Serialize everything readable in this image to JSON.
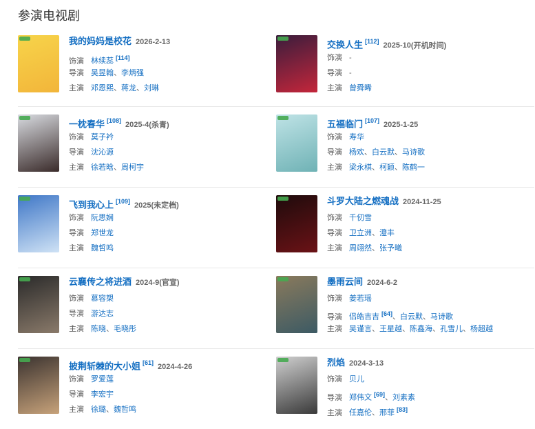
{
  "section_title": "参演电视剧",
  "labels": {
    "role": "饰演",
    "director": "导演",
    "starring": "主演"
  },
  "shows": [
    {
      "title": "我的妈妈是校花",
      "ref": "",
      "date": "2026-2-13",
      "extra": "",
      "role": [
        {
          "t": "林续蕊",
          "ref": "[114]"
        }
      ],
      "director": [
        {
          "t": "吴昱翰"
        },
        {
          "t": "李炳强"
        }
      ],
      "starring": [
        {
          "t": "邓恩熙"
        },
        {
          "t": "蒋龙"
        },
        {
          "t": "刘琳"
        }
      ],
      "poster_colors": [
        "#f7d44a",
        "#f2b53a"
      ]
    },
    {
      "title": "交换人生",
      "ref": "[112]",
      "date": "2025-10",
      "extra": "(开机时间)",
      "role_plain": "-",
      "director_plain": "-",
      "starring": [
        {
          "t": "曾舜晞"
        }
      ],
      "poster_colors": [
        "#3a1d3c",
        "#c4263b"
      ]
    },
    {
      "title": "一枕春华",
      "ref": "[108]",
      "date": "2025-4",
      "extra": "(杀青)",
      "role": [
        {
          "t": "莫子衿"
        }
      ],
      "director": [
        {
          "t": "沈沁源"
        }
      ],
      "starring": [
        {
          "t": "徐若晗"
        },
        {
          "t": "周柯宇"
        }
      ],
      "poster_colors": [
        "#d8dbe0",
        "#3a2b2a"
      ]
    },
    {
      "title": "五福临门",
      "ref": "[107]",
      "date": "2025-1-25",
      "extra": "",
      "role": [
        {
          "t": "寿华"
        }
      ],
      "director": [
        {
          "t": "杨欢"
        },
        {
          "t": "白云默"
        },
        {
          "t": "马诗歌"
        }
      ],
      "starring": [
        {
          "t": "梁永棋"
        },
        {
          "t": "柯颖"
        },
        {
          "t": "陈鹤一"
        }
      ],
      "poster_colors": [
        "#bfe3e6",
        "#6fb2b5"
      ]
    },
    {
      "title": "飞到我心上",
      "ref": "[109]",
      "date": "2025(未定档)",
      "extra": "",
      "role": [
        {
          "t": "阮思娴"
        }
      ],
      "director": [
        {
          "t": "郑世龙"
        }
      ],
      "starring": [
        {
          "t": "魏哲鸣"
        }
      ],
      "poster_colors": [
        "#3f77c7",
        "#cfe2f5"
      ]
    },
    {
      "title": "斗罗大陆之燃魂战",
      "ref": "",
      "date": "2024-11-25",
      "extra": "",
      "role": [
        {
          "t": "千仞雪"
        }
      ],
      "director": [
        {
          "t": "卫立洲"
        },
        {
          "t": "澄丰"
        }
      ],
      "starring": [
        {
          "t": "周翊然"
        },
        {
          "t": "张予曦"
        }
      ],
      "poster_colors": [
        "#1e0b0c",
        "#6b1216"
      ]
    },
    {
      "title": "云襄传之将进酒",
      "ref": "",
      "date": "2024-9(官宣)",
      "extra": "",
      "role": [
        {
          "t": "慕容槊"
        }
      ],
      "director": [
        {
          "t": "游达志"
        }
      ],
      "starring": [
        {
          "t": "陈晓"
        },
        {
          "t": "毛晓彤"
        }
      ],
      "poster_colors": [
        "#2a2a2a",
        "#8a7a6a"
      ]
    },
    {
      "title": "墨雨云间",
      "ref": "",
      "date": "2024-6-2",
      "extra": "",
      "role": [
        {
          "t": "姜若瑶"
        }
      ],
      "director": [
        {
          "t": "侣皓吉吉",
          "ref": "[64]"
        },
        {
          "t": "白云默"
        },
        {
          "t": "马诗歌"
        }
      ],
      "starring": [
        {
          "t": "吴谨言"
        },
        {
          "t": "王星越"
        },
        {
          "t": "陈鑫海"
        },
        {
          "t": "孔雪儿"
        },
        {
          "t": "杨超越"
        }
      ],
      "poster_colors": [
        "#8a7a5c",
        "#3c5a64"
      ]
    },
    {
      "title": "披荆斩棘的大小姐",
      "ref": "[61]",
      "date": "2024-4-26",
      "extra": "",
      "role": [
        {
          "t": "罗爱莲"
        }
      ],
      "director": [
        {
          "t": "李宏宇"
        }
      ],
      "starring": [
        {
          "t": "徐璐"
        },
        {
          "t": "魏哲鸣"
        }
      ],
      "poster_colors": [
        "#3b3330",
        "#c7a27a"
      ]
    },
    {
      "title": "烈焰",
      "ref": "",
      "date": "2024-3-13",
      "extra": "",
      "role": [
        {
          "t": "贝儿"
        }
      ],
      "director": [
        {
          "t": "郑伟文",
          "ref": "[69]"
        },
        {
          "t": "刘素素"
        }
      ],
      "starring": [
        {
          "t": "任嘉伦"
        },
        {
          "t": "邢菲",
          "ref": "[83]"
        }
      ],
      "poster_colors": [
        "#cfcfcf",
        "#3a3a3a"
      ]
    }
  ]
}
